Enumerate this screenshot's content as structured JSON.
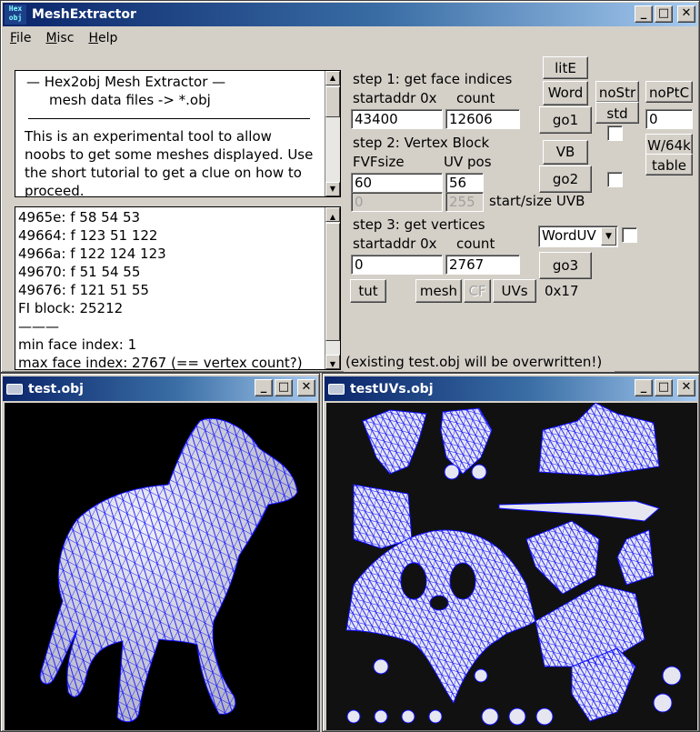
{
  "app": {
    "title": "MeshExtractor",
    "icon_text": "Hex\nobj"
  },
  "menu": [
    "File",
    "Misc",
    "Help"
  ],
  "window_buttons": {
    "min": "_",
    "max": "□",
    "close": "✕"
  },
  "intro": {
    "title": "—   Hex2obj Mesh Extractor   —",
    "subtitle": "mesh data files -> *.obj",
    "body": "This is an experimental tool to allow noobs to get some meshes displayed. Use the short tutorial to get a clue on how to proceed."
  },
  "log": {
    "lines": [
      "4965e: f  58 54 53",
      "49664: f  123 51 122",
      "4966a: f  122 124 123",
      "49670: f  51 54 55",
      "49676: f  121 51 55",
      "FI block: 25212",
      "———",
      "min face index: 1",
      "max face index: 2767 (== vertex count?)"
    ]
  },
  "step1": {
    "label": "step 1: get face indices",
    "addr_label": "startaddr 0x",
    "count_label": "count",
    "addr": "43400",
    "count": "12606",
    "go": "go1"
  },
  "step2": {
    "label": "step 2: Vertex Block",
    "fvf_label": "FVFsize",
    "uv_label": "UV pos",
    "fvf": "60",
    "uv": "56",
    "uvb_start": "0",
    "uvb_size": "255",
    "uvb_label": "start/size UVB",
    "go": "go2"
  },
  "step3": {
    "label": "step 3: get vertices",
    "addr_label": "startaddr 0x",
    "count_label": "count",
    "addr": "0",
    "count": "2767",
    "go": "go3"
  },
  "buttons": {
    "lite": "litE",
    "word": "Word",
    "nostr": "noStr",
    "noptc": "noPtC",
    "std": "std",
    "vb": "VB",
    "w64k": "W/64k",
    "table": "table",
    "tut": "tut",
    "mesh": "mesh",
    "cf": "CF",
    "uvs": "UVs",
    "hex": "0x17",
    "ptc_value": "0"
  },
  "uv_select": "WordUV",
  "warning": "(existing test.obj will be overwritten!)",
  "subwin1": {
    "title": "test.obj"
  },
  "subwin2": {
    "title": "testUVs.obj"
  },
  "colors": {
    "wire": "#1010ff",
    "mesh_fill": "#e6e6f0",
    "view_bg": "#000000",
    "uv_bg": "#111111"
  }
}
